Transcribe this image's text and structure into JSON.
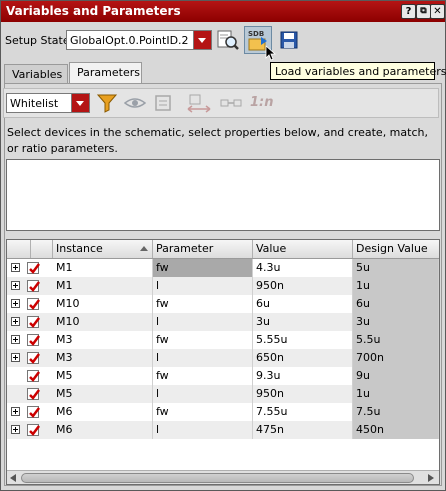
{
  "window": {
    "title": "Variables and Parameters",
    "help_btn": "?",
    "restore_btn": "⧉",
    "close_btn": "✕"
  },
  "toolbar": {
    "setup_state_label": "Setup State:",
    "setup_state_value": "GlobalOpt.0.PointID.2",
    "tooltip": "Load variables and parameters"
  },
  "tabs": [
    {
      "label": "Variables"
    },
    {
      "label": "Parameters"
    }
  ],
  "params_toolbar": {
    "filter_value": "Whitelist",
    "ratio_label": "1:n"
  },
  "description": "Select devices in the schematic, select properties below, and create, match, or ratio parameters.",
  "table": {
    "columns": [
      "Instance",
      "Parameter",
      "Value",
      "Design Value"
    ],
    "rows": [
      {
        "expand": true,
        "checked": true,
        "instance": "M1",
        "parameter": "fw",
        "value": "4.3u",
        "design_value": "5u"
      },
      {
        "expand": true,
        "checked": true,
        "instance": "M1",
        "parameter": "l",
        "value": "950n",
        "design_value": "1u"
      },
      {
        "expand": true,
        "checked": true,
        "instance": "M10",
        "parameter": "fw",
        "value": "6u",
        "design_value": "6u"
      },
      {
        "expand": true,
        "checked": true,
        "instance": "M10",
        "parameter": "l",
        "value": "3u",
        "design_value": "3u"
      },
      {
        "expand": true,
        "checked": true,
        "instance": "M3",
        "parameter": "fw",
        "value": "5.55u",
        "design_value": "5.5u"
      },
      {
        "expand": true,
        "checked": true,
        "instance": "M3",
        "parameter": "l",
        "value": "650n",
        "design_value": "700n"
      },
      {
        "expand": false,
        "checked": true,
        "instance": "M5",
        "parameter": "fw",
        "value": "9.3u",
        "design_value": "9u"
      },
      {
        "expand": false,
        "checked": true,
        "instance": "M5",
        "parameter": "l",
        "value": "950n",
        "design_value": "1u"
      },
      {
        "expand": true,
        "checked": true,
        "instance": "M6",
        "parameter": "fw",
        "value": "7.55u",
        "design_value": "7.5u"
      },
      {
        "expand": true,
        "checked": true,
        "instance": "M6",
        "parameter": "l",
        "value": "475n",
        "design_value": "450n"
      }
    ]
  },
  "colors": {
    "title_bar": "#a00000",
    "accent_red": "#b41414",
    "check_red": "#cc0000"
  }
}
